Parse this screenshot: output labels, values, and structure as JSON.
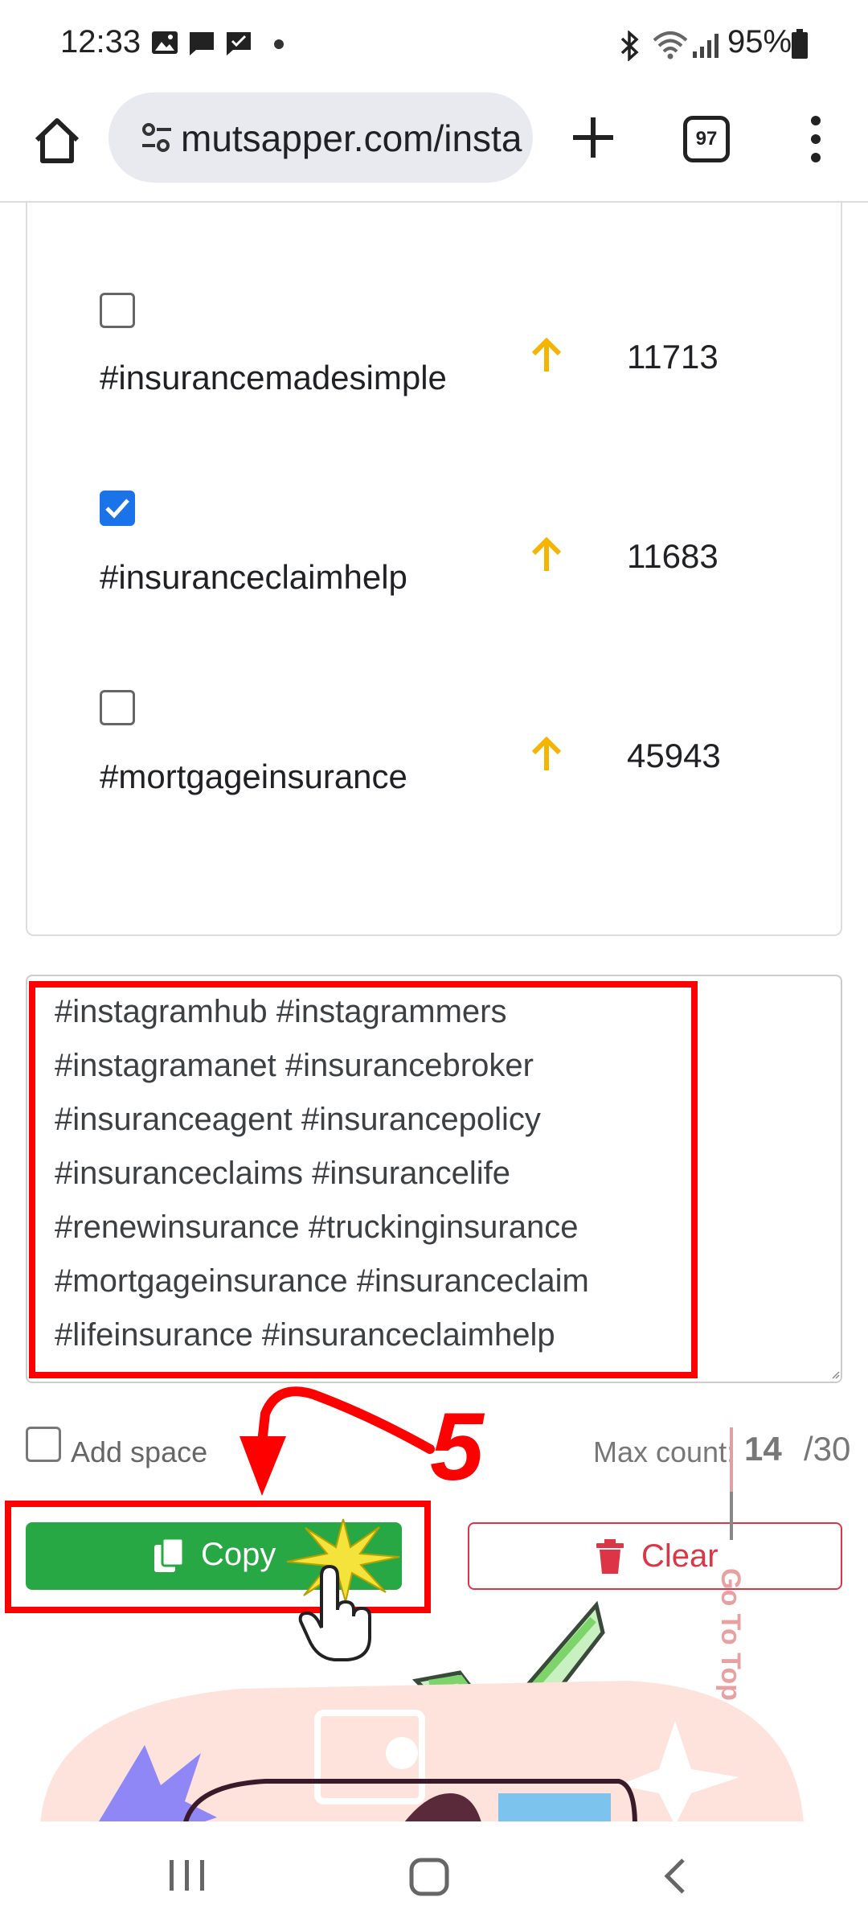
{
  "status_bar": {
    "time": "12:33",
    "battery": "95%",
    "icons": [
      "image-icon",
      "message-icon",
      "chat-check-icon",
      "dot-icon",
      "bluetooth-icon",
      "wifi-icon",
      "signal-icon",
      "battery-icon"
    ]
  },
  "browser": {
    "url": "mutsapper.com/insta",
    "tab_count": "97"
  },
  "hashtags": [
    {
      "tag": "#insurancemadesimple",
      "count": "11713",
      "checked": false
    },
    {
      "tag": "#insuranceclaimhelp",
      "count": "11683",
      "checked": true
    },
    {
      "tag": "#mortgageinsurance",
      "count": "45943",
      "checked": false
    }
  ],
  "textarea": {
    "lines": [
      "#instagramhub #instagrammers",
      "#instagramanet #insurancebroker",
      "#insuranceagent #insurancepolicy",
      "#insuranceclaims #insurancelife",
      "#renewinsurance #truckinginsurance",
      "#mortgageinsurance #insuranceclaim",
      "#lifeinsurance #insuranceclaimhelp"
    ]
  },
  "options": {
    "add_space_label": "Add space",
    "max_count_label": "Max count:",
    "max_count_value": "14",
    "max_count_limit": "/30"
  },
  "buttons": {
    "copy_label": "Copy",
    "clear_label": "Clear"
  },
  "annotation": {
    "step_number": "5"
  },
  "go_to_top_label": "Go To Top",
  "colors": {
    "copy_green": "#28a745",
    "clear_red": "#dc3545",
    "checkbox_blue": "#1a73e8",
    "arrow_yellow": "#f4b400",
    "annotation_red": "#ff0000"
  }
}
